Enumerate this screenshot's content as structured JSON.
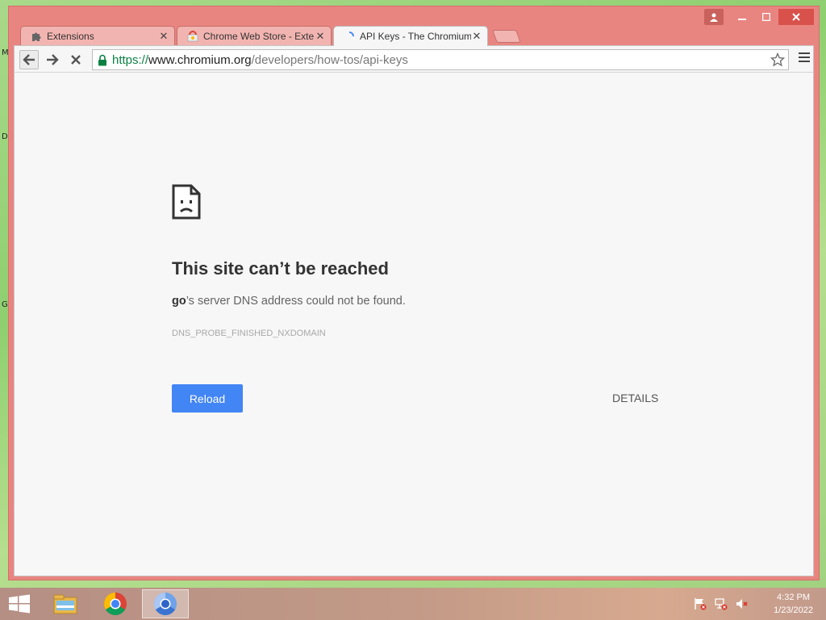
{
  "desktop": {
    "glyphs": [
      "M",
      "D",
      "G"
    ]
  },
  "tabs": [
    {
      "title": "Extensions",
      "icon": "puzzle-icon"
    },
    {
      "title": "Chrome Web Store - Exte",
      "icon": "webstore-icon"
    },
    {
      "title": "API Keys - The Chromium",
      "icon": "loading-spinner-icon",
      "active": true
    }
  ],
  "toolbar": {
    "url_scheme": "https://",
    "url_host": "www.chromium.org",
    "url_path": "/developers/how-tos/api-keys"
  },
  "error_page": {
    "heading": "This site can’t be reached",
    "host": "go",
    "summary_rest": "’s server DNS address could not be found.",
    "error_code": "DNS_PROBE_FINISHED_NXDOMAIN",
    "reload_label": "Reload",
    "details_label": "DETAILS"
  },
  "taskbar": {
    "apps": [
      "file-explorer-icon",
      "chrome-icon",
      "chromium-icon"
    ],
    "tray_icons": [
      "action-center-flag-icon",
      "network-icon",
      "volume-muted-icon"
    ],
    "time": "4:32 PM",
    "date": "1/23/2022"
  },
  "colors": {
    "frame": "#e98580",
    "accent_button": "#4285f4",
    "secure_green": "#0b8043"
  }
}
